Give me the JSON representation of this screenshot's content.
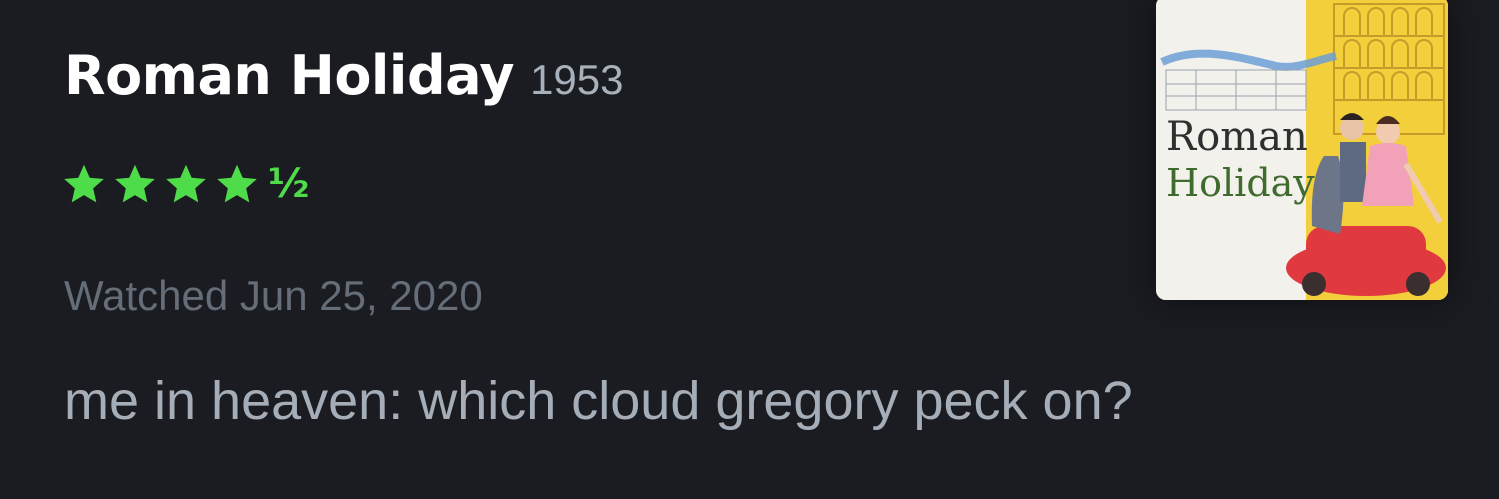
{
  "film": {
    "title": "Roman Holiday",
    "year": "1953"
  },
  "rating": {
    "stars": 4.5,
    "max": 5,
    "half_glyph": "½",
    "color": "#4fdc4a"
  },
  "watched": {
    "text": "Watched Jun 25, 2020"
  },
  "review": {
    "text": "me in heaven: which cloud gregory peck on?"
  },
  "poster": {
    "title_line1": "Roman",
    "title_line2": "Holiday"
  },
  "colors": {
    "background": "#1b1c21",
    "title": "#ffffff",
    "muted": "#646d78",
    "body_text": "#a5aeb8"
  }
}
